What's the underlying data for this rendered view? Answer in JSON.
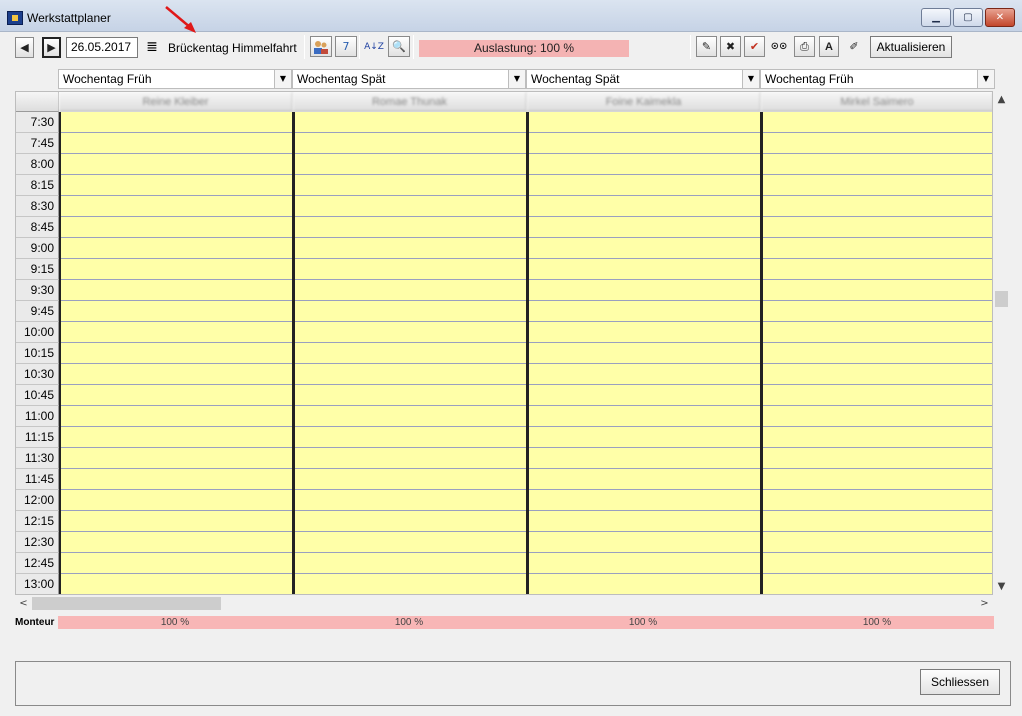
{
  "window": {
    "title": "Werkstattplaner",
    "minimize_glyph": "▁",
    "maximize_glyph": "▢",
    "close_glyph": "✕"
  },
  "toolbar": {
    "prev_glyph": "◀",
    "next_glyph": "▶",
    "date": "26.05.2017",
    "menu_glyph": "≣",
    "holiday": "Brückentag Himmelfahrt",
    "sort_glyph": "A↓Z",
    "search_glyph": "🔍",
    "calendar_glyph": "7",
    "load_label": "Auslastung: 100 %",
    "icon_glyphs": [
      "✎",
      "✖",
      "✔",
      "⊙⊙",
      "⎙",
      "A",
      "✐"
    ],
    "refresh_label": "Aktualisieren"
  },
  "shifts": [
    {
      "label": "Wochentag Früh",
      "arrow": "▼"
    },
    {
      "label": "Wochentag Spät",
      "arrow": "▼"
    },
    {
      "label": "Wochentag Spät",
      "arrow": "▼"
    },
    {
      "label": "Wochentag Früh",
      "arrow": "▼"
    }
  ],
  "mechanics": [
    "Reine Kleiber",
    "Romae Thunak",
    "Foine Kaimekla",
    "Mirkel Saimero"
  ],
  "times": [
    "7:30",
    "7:45",
    "8:00",
    "8:15",
    "8:30",
    "8:45",
    "9:00",
    "9:15",
    "9:30",
    "9:45",
    "10:00",
    "10:15",
    "10:30",
    "10:45",
    "11:00",
    "11:15",
    "11:30",
    "11:45",
    "12:00",
    "12:15",
    "12:30",
    "12:45",
    "13:00"
  ],
  "scroll": {
    "up": "▲",
    "down": "▼",
    "left": "<",
    "right": ">"
  },
  "monteur": {
    "label": "Monteur",
    "utilization": [
      "100 %",
      "100 %",
      "100 %",
      "100 %"
    ]
  },
  "footer": {
    "close_label": "Schliessen"
  },
  "colors": {
    "slot": "#ffffa8",
    "load": "#f4b3b3",
    "arrow": "#e01818"
  }
}
